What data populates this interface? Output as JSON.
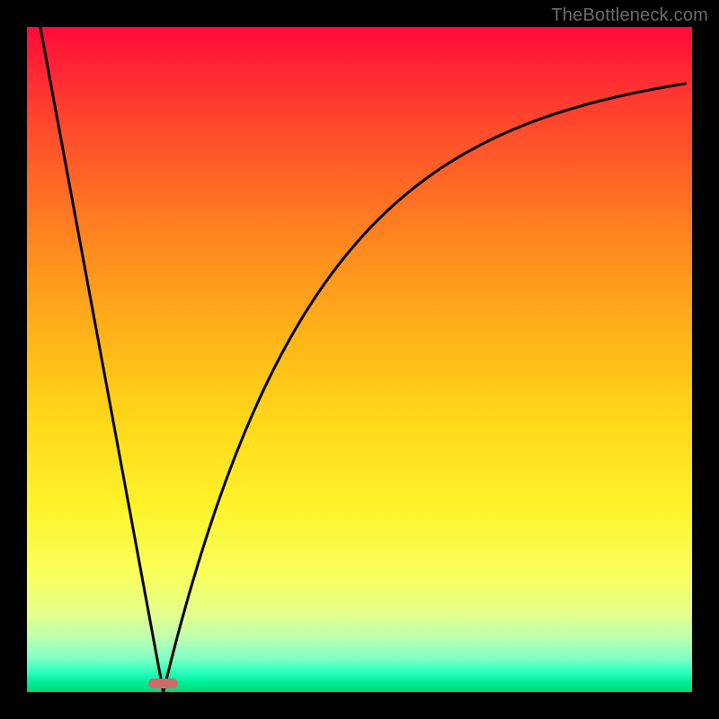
{
  "watermark": "TheBottleneck.com",
  "chart_data": {
    "type": "line",
    "title": "",
    "xlabel": "",
    "ylabel": "",
    "xlim": [
      0,
      1
    ],
    "ylim": [
      0,
      1
    ],
    "x_min_frac": 0.205,
    "left_branch": {
      "x_start": 0.02,
      "y_start": 1.0
    },
    "right_branch_params": {
      "a": 0.91,
      "b": 4.5,
      "c": 0.04
    },
    "right_branch_xmax": 0.99,
    "marker": {
      "x_center_frac": 0.205,
      "y_frac": 0.005,
      "w_frac": 0.045,
      "h_frac": 0.015,
      "color": "#cf6a6a"
    },
    "gradient_stops": [
      {
        "pos": 0.0,
        "color": "#ff0a3a"
      },
      {
        "pos": 0.5,
        "color": "#ffda1a"
      },
      {
        "pos": 0.8,
        "color": "#f9ff5a"
      },
      {
        "pos": 1.0,
        "color": "#00d873"
      }
    ]
  }
}
